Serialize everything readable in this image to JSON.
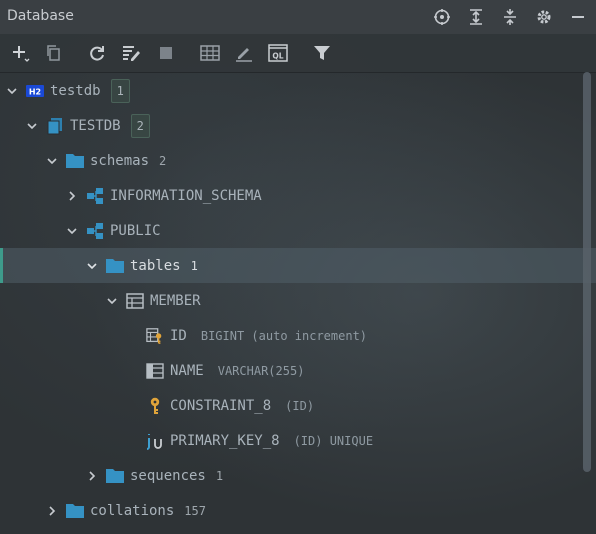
{
  "panel": {
    "title": "Database"
  },
  "title_icons": [
    "locate-icon",
    "expand-all-icon",
    "collapse-all-icon",
    "gear-icon",
    "minimize-icon"
  ],
  "toolbar": {
    "icons": [
      "add-icon",
      "copy-icon",
      "refresh-icon",
      "edit-properties-icon",
      "stop-icon",
      "table-editor-icon",
      "edit-icon",
      "query-console-icon",
      "filter-icon"
    ],
    "query_console_text": "QL"
  },
  "tree": {
    "testdb": {
      "label": "testdb",
      "badge": "1",
      "type_icon_text": "H2"
    },
    "TESTDB": {
      "label": "TESTDB",
      "badge": "2"
    },
    "schemas": {
      "label": "schemas",
      "count": "2"
    },
    "information_schema": {
      "label": "INFORMATION_SCHEMA"
    },
    "public": {
      "label": "PUBLIC"
    },
    "tables": {
      "label": "tables",
      "count": "1"
    },
    "member": {
      "label": "MEMBER"
    },
    "col_id": {
      "label": "ID",
      "detail": "BIGINT (auto increment)"
    },
    "col_name": {
      "label": "NAME",
      "detail": "VARCHAR(255)"
    },
    "constraint": {
      "label": "CONSTRAINT_8",
      "detail": "(ID)"
    },
    "primary_key": {
      "label": "PRIMARY_KEY_8",
      "detail": "(ID) UNIQUE"
    },
    "sequences": {
      "label": "sequences",
      "count": "1"
    },
    "collations": {
      "label": "collations",
      "count": "157"
    }
  },
  "colors": {
    "accent": "#3e9b8b",
    "folder": "#3592c4",
    "key": "#e0a43a",
    "h2": "#1a49d6"
  }
}
